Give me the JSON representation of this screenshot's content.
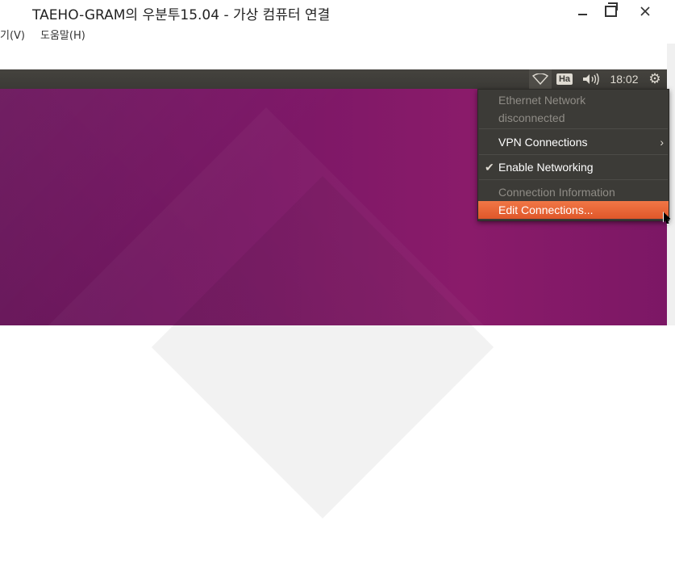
{
  "window": {
    "title": "TAEHO-GRAM의 우분투15.04 - 가상 컴퓨터 연결",
    "minimize_icon": "minimize-icon",
    "maximize_icon": "maximize-icon",
    "close_icon": "close-icon"
  },
  "menubar": {
    "items": [
      {
        "label": "기(V)"
      },
      {
        "label": "도움말(H)"
      }
    ]
  },
  "panel": {
    "clock": "18:02",
    "keyboard_indicator": "Ha",
    "wifi_icon": "network-icon",
    "volume_icon": "volume-icon",
    "gear_icon": "gear-icon"
  },
  "network_menu": {
    "ethernet_title": "Ethernet Network",
    "ethernet_status": "disconnected",
    "vpn_label": "VPN Connections",
    "enable_networking_label": "Enable Networking",
    "enable_networking_checked": true,
    "connection_info_label": "Connection Information",
    "edit_connections_label": "Edit Connections...",
    "highlight_color": "#e95420"
  },
  "colors": {
    "panel_bg": "#3c3b37",
    "desktop_bg": "#77216f",
    "accent": "#e95420"
  }
}
